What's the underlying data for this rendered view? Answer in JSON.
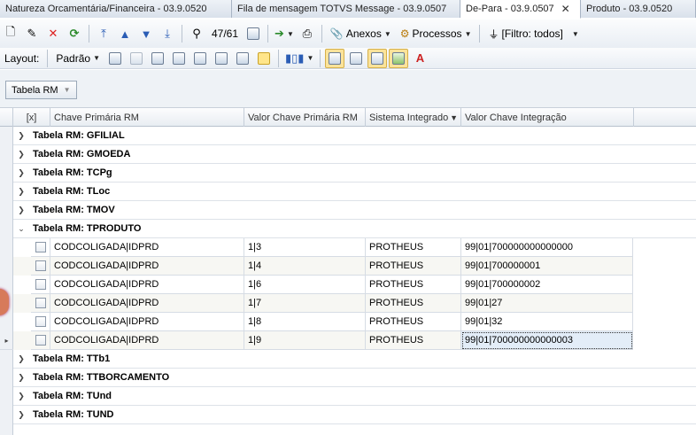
{
  "tabs": [
    {
      "label": "Natureza Orcamentária/Financeira - 03.9.0520",
      "active": false
    },
    {
      "label": "Fila de mensagem TOTVS Message - 03.9.0507",
      "active": false
    },
    {
      "label": "De-Para - 03.9.0507",
      "active": true
    },
    {
      "label": "Produto - 03.9.0520",
      "active": false
    }
  ],
  "toolbar": {
    "record_counter": "47/61",
    "attachments_label": "Anexos",
    "processes_label": "Processos",
    "filter_label": "[Filtro: todos]"
  },
  "toolbar2": {
    "layout_label": "Layout:",
    "layout_value": "Padrão"
  },
  "group_panel": {
    "chip_label": "Tabela RM"
  },
  "grid": {
    "columns": [
      {
        "label": "[x]"
      },
      {
        "label": "Chave Primária RM"
      },
      {
        "label": "Valor Chave Primária RM"
      },
      {
        "label": "Sistema Integrado"
      },
      {
        "label": "Valor Chave Integração"
      }
    ],
    "groups_before": [
      "Tabela RM: GFILIAL",
      "Tabela RM: GMOEDA",
      "Tabela RM: TCPg",
      "Tabela RM: TLoc",
      "Tabela RM: TMOV"
    ],
    "expanded_group": "Tabela RM: TPRODUTO",
    "rows": [
      {
        "chave": "CODCOLIGADA|IDPRD",
        "valor": "1|3",
        "sistema": "PROTHEUS",
        "integracao": "99|01|700000000000000"
      },
      {
        "chave": "CODCOLIGADA|IDPRD",
        "valor": "1|4",
        "sistema": "PROTHEUS",
        "integracao": "99|01|700000001"
      },
      {
        "chave": "CODCOLIGADA|IDPRD",
        "valor": "1|6",
        "sistema": "PROTHEUS",
        "integracao": "99|01|700000002"
      },
      {
        "chave": "CODCOLIGADA|IDPRD",
        "valor": "1|7",
        "sistema": "PROTHEUS",
        "integracao": "99|01|27"
      },
      {
        "chave": "CODCOLIGADA|IDPRD",
        "valor": "1|8",
        "sistema": "PROTHEUS",
        "integracao": "99|01|32"
      },
      {
        "chave": "CODCOLIGADA|IDPRD",
        "valor": "1|9",
        "sistema": "PROTHEUS",
        "integracao": "99|01|700000000000003"
      }
    ],
    "groups_after": [
      "Tabela RM: TTb1",
      "Tabela RM: TTBORCAMENTO",
      "Tabela RM: TUnd",
      "Tabela RM: TUND"
    ]
  }
}
